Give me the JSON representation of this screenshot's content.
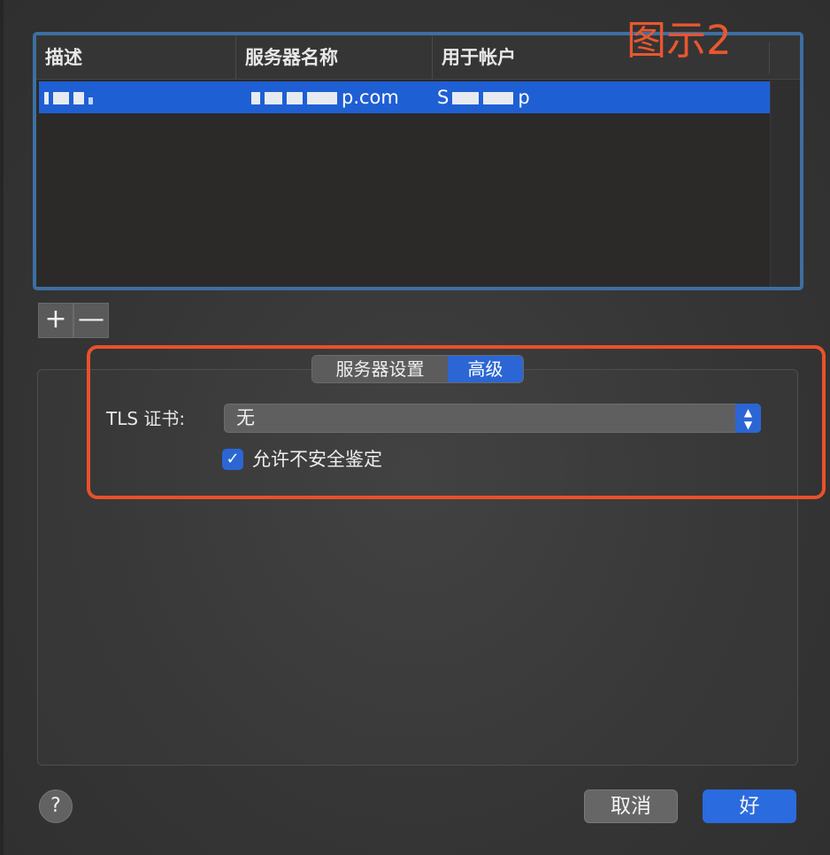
{
  "annotation": {
    "title": "图示2"
  },
  "table": {
    "columns": [
      "描述",
      "服务器名称",
      "用于帐户"
    ],
    "selected_row": {
      "description": "I. .",
      "server_suffix": "p.com",
      "account_prefix": "S",
      "account_suffix": "p"
    }
  },
  "list_controls": {
    "add": "+",
    "remove": "—"
  },
  "tabs": {
    "server_settings": "服务器设置",
    "advanced": "高级"
  },
  "advanced": {
    "tls_label": "TLS 证书:",
    "tls_value": "无",
    "allow_insecure_label": "允许不安全鉴定",
    "allow_insecure_checked": true
  },
  "footer": {
    "help": "?",
    "cancel": "取消",
    "ok": "好"
  },
  "colors": {
    "accent": "#2b66d4",
    "annotation": "#e9512a",
    "selection": "#1f5fd4"
  }
}
